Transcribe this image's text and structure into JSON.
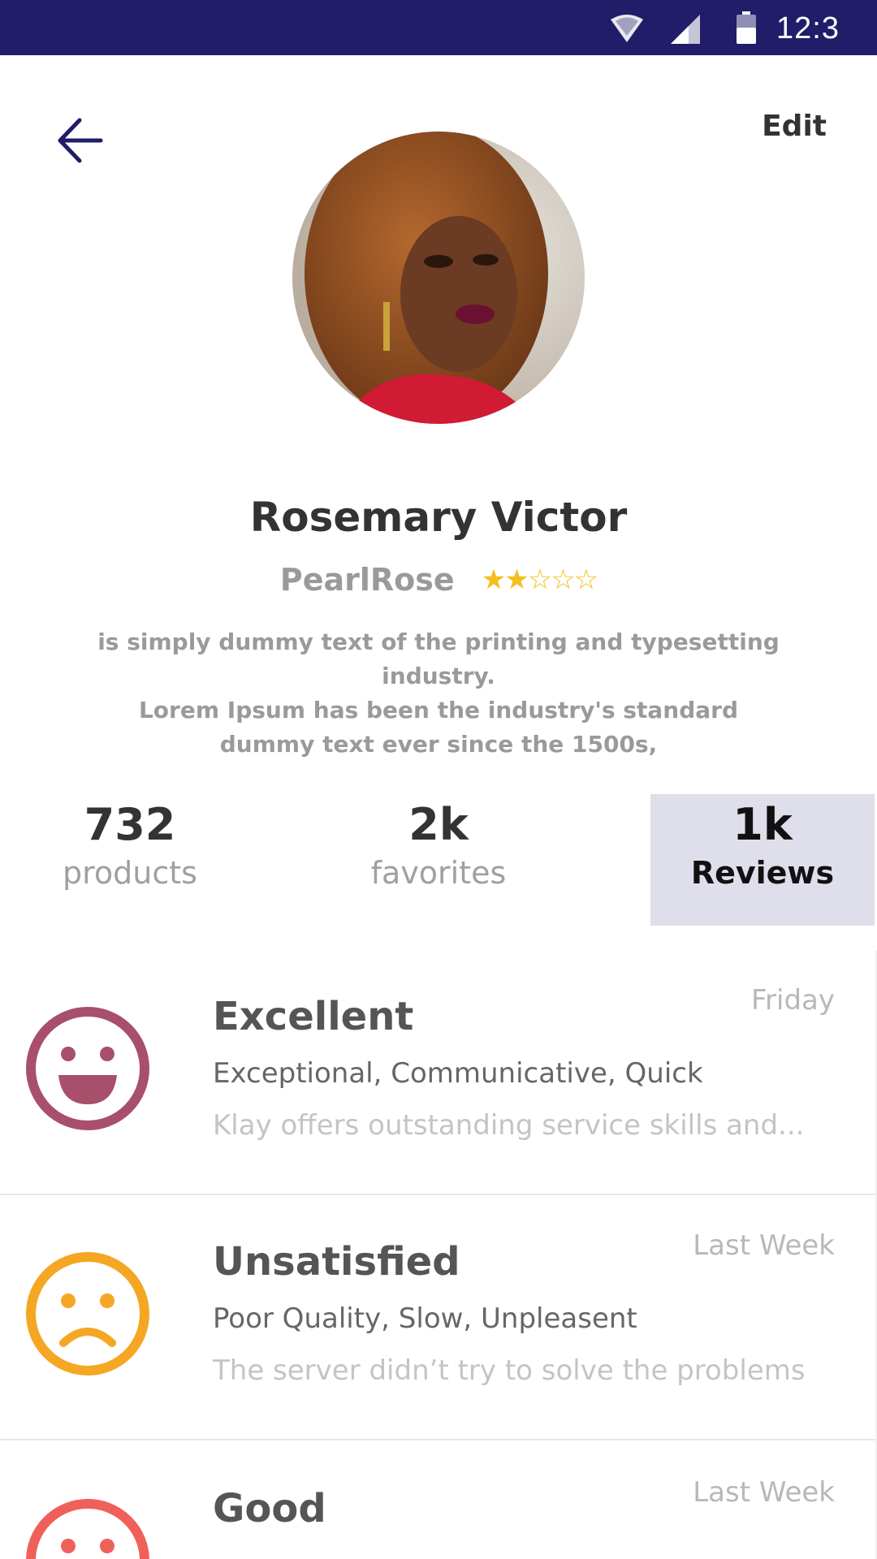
{
  "status_bar": {
    "time": "12:3",
    "background": "#211d68"
  },
  "header": {
    "edit_label": "Edit",
    "back_icon": "arrow-left-icon"
  },
  "profile": {
    "name": "Rosemary Victor",
    "username": "PearlRose",
    "rating": 2,
    "rating_max": 5,
    "bio_lines": [
      "is simply dummy text of the printing and typesetting industry.",
      "Lorem Ipsum has been the industry's standard",
      "dummy text ever since the 1500s,"
    ]
  },
  "stats": [
    {
      "value": "732",
      "label": "products"
    },
    {
      "value": "2k",
      "label": "favorites"
    },
    {
      "value": "1k",
      "label": "Reviews"
    }
  ],
  "reviews": [
    {
      "title": "Excellent",
      "tags": "Exceptional, Communicative, Quick",
      "summary": "Klay offers outstanding service skills and...",
      "date": "Friday",
      "icon": "smiley-happy-icon",
      "color": "#a84f6c"
    },
    {
      "title": "Unsatisfied",
      "tags": "Poor Quality, Slow, Unpleasent",
      "summary": "The server didn’t try to solve the problems",
      "date": "Last Week",
      "icon": "smiley-sad-icon",
      "color": "#f5a623"
    },
    {
      "title": "Good",
      "tags": "",
      "summary": "",
      "date": "Last Week",
      "icon": "smiley-icon",
      "color": "#f0605a"
    }
  ],
  "colors": {
    "accent": "#211d68",
    "star": "#f2c01c",
    "active_tab_bg": "#dfdfeb"
  }
}
